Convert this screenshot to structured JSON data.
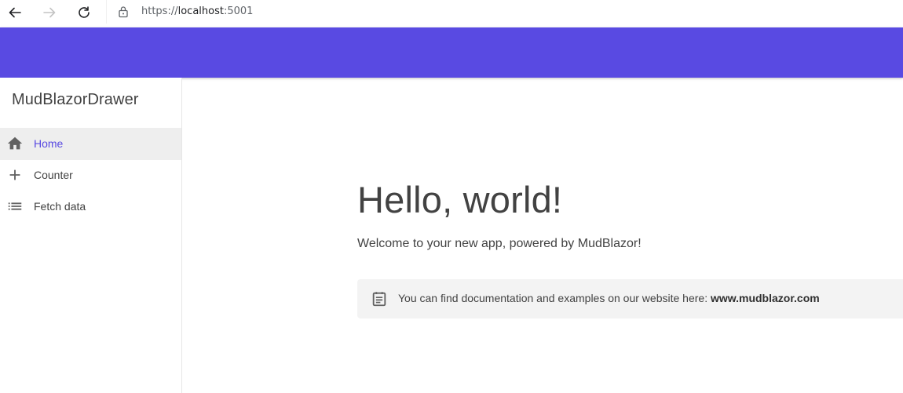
{
  "browser": {
    "url_scheme": "https://",
    "url_host": "localhost",
    "url_port": ":5001"
  },
  "colors": {
    "primary": "#594ae2",
    "active_nav_text": "#594ae2",
    "text": "#424242"
  },
  "drawer": {
    "title": "MudBlazorDrawer",
    "items": [
      {
        "label": "Home",
        "icon": "home-icon",
        "active": true
      },
      {
        "label": "Counter",
        "icon": "plus-icon",
        "active": false
      },
      {
        "label": "Fetch data",
        "icon": "list-icon",
        "active": false
      }
    ]
  },
  "main": {
    "heading": "Hello, world!",
    "welcome": "Welcome to your new app, powered by MudBlazor!",
    "alert": {
      "icon": "document-icon",
      "text": "You can find documentation and examples on our website here: ",
      "link": "www.mudblazor.com"
    }
  }
}
